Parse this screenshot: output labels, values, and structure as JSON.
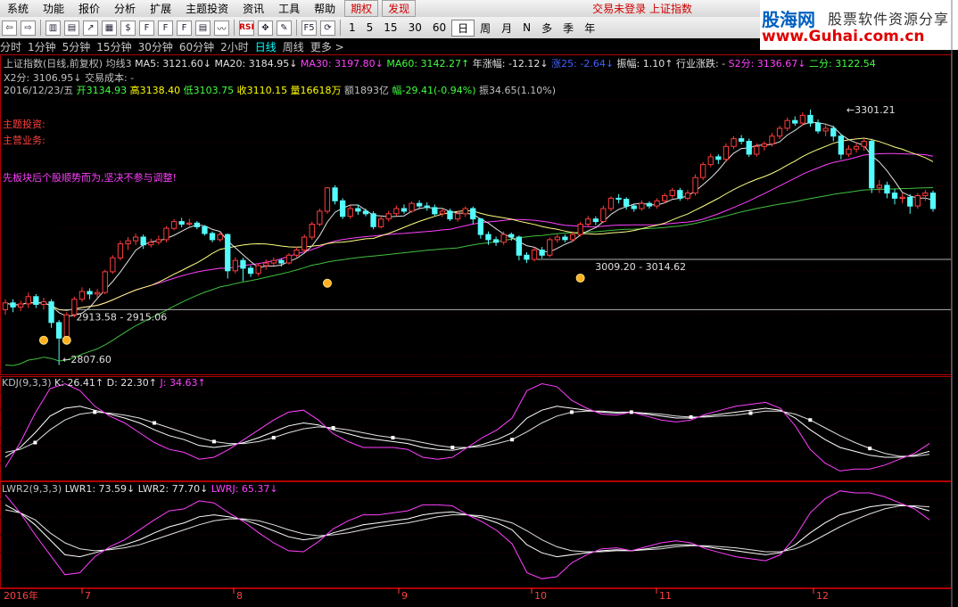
{
  "menu": {
    "items": [
      "系统",
      "功能",
      "报价",
      "分析",
      "扩展",
      "主题投资",
      "资讯",
      "工具",
      "帮助"
    ],
    "boxed": [
      "期权",
      "发现"
    ],
    "status": "交易未登录",
    "index_name": "上证指数"
  },
  "toolbar": {
    "icons": [
      "left-icon",
      "right-icon",
      "kline-icon",
      "bars-icon",
      "trend-icon",
      "grid-icon",
      "fund-icon",
      "f10-icon",
      "f10x-icon",
      "fiz-icon",
      "table-icon",
      "scan-icon",
      "rsi-icon",
      "move-icon",
      "pen-icon",
      "f5-icon",
      "refresh-icon"
    ],
    "rsi_label": "RSI",
    "periods": [
      "1",
      "5",
      "15",
      "30",
      "60",
      "日",
      "周",
      "月",
      "N",
      "多",
      "季",
      "年"
    ],
    "selected_period": "日"
  },
  "logo": {
    "name": "股海网",
    "slogan": "股票软件资源分享",
    "url": "www.Guhai.com.cn"
  },
  "period_bar": {
    "items": [
      "分时",
      "1分钟",
      "5分钟",
      "15分钟",
      "30分钟",
      "60分钟",
      "2小时",
      "日线",
      "周线",
      "更多 >"
    ],
    "current": "日线"
  },
  "info": {
    "line1": [
      {
        "text": "上证指数(日线,前复权) 均线3",
        "color": "#c0c0c0"
      },
      {
        "text": " MA5: 3121.60↓",
        "color": "#e0e0e0"
      },
      {
        "text": " MA20: 3184.95↓",
        "color": "#e0e0e0"
      },
      {
        "text": " MA30: 3197.80↓",
        "color": "#ff40ff"
      },
      {
        "text": " MA60: 3142.27↑",
        "color": "#40ff40"
      },
      {
        "text": "  年涨幅: -12.12↓",
        "color": "#e0e0e0"
      },
      {
        "text": " 涨25: -2.64↓",
        "color": "#4060ff"
      },
      {
        "text": " 振幅: 1.10↑",
        "color": "#e0e0e0"
      },
      {
        "text": " 行业涨跌: -",
        "color": "#e0e0e0"
      },
      {
        "text": " S2分: 3136.67↓",
        "color": "#ff40ff"
      },
      {
        "text": " 二分: 3122.54",
        "color": "#40ff40"
      }
    ],
    "line2": "X2分: 3106.95↓  交易成本: -",
    "line3": [
      {
        "text": "2016/12/23/五 ",
        "color": "#c0c0c0"
      },
      {
        "text": "开3134.93",
        "color": "#40ff40"
      },
      {
        "text": " 高3138.40",
        "color": "#ffff00"
      },
      {
        "text": " 低3103.75",
        "color": "#40ff40"
      },
      {
        "text": " 收3110.15",
        "color": "#ffff00"
      },
      {
        "text": " 量16618万",
        "color": "#ffff00"
      },
      {
        "text": " 额1893亿",
        "color": "#c0c0c0"
      },
      {
        "text": " 幅-29.41(-0.94%)",
        "color": "#40ff40"
      },
      {
        "text": " 振34.65(1.10%)",
        "color": "#c0c0c0"
      }
    ]
  },
  "annotations": {
    "a1": "主题投资:",
    "a2": "主营业务:",
    "a3": "先板块后个股顺势而为,坚决不参与调整!"
  },
  "price_labels": {
    "high": "3301.21",
    "low": "2807.60",
    "range1": "2913.58 - 2915.06",
    "range2": "3009.20 - 3014.62"
  },
  "kdj": {
    "label": "KDJ(9,3,3)",
    "k": "K: 26.41↑",
    "d": "D: 22.30↑",
    "j": "J: 34.63↑"
  },
  "lwr": {
    "label": "LWR2(9,3,3)",
    "lwr1": "LWR1: 73.59↓",
    "lwr2": "LWR2: 77.70↓",
    "lwrj": "LWRJ: 65.37↓"
  },
  "xaxis": {
    "year": "2016年",
    "months": [
      "7",
      "8",
      "9",
      "10",
      "11",
      "12"
    ]
  },
  "colors": {
    "up": "#ff3c3c",
    "down": "#54fcfc",
    "ma5": "#e0e0e0",
    "ma_yellow": "#ffff80",
    "ma_purple": "#ff40ff",
    "ma_green": "#40c040",
    "border": "#b00000"
  },
  "chart_data": {
    "type": "candlestick",
    "series_order": [
      "open",
      "close",
      "high",
      "low"
    ],
    "candles": [
      [
        2915,
        2928,
        2935,
        2905
      ],
      [
        2928,
        2920,
        2935,
        2910
      ],
      [
        2920,
        2926,
        2932,
        2912
      ],
      [
        2926,
        2940,
        2948,
        2918
      ],
      [
        2940,
        2925,
        2945,
        2918
      ],
      [
        2925,
        2930,
        2938,
        2915
      ],
      [
        2930,
        2890,
        2935,
        2880
      ],
      [
        2890,
        2860,
        2895,
        2808
      ],
      [
        2860,
        2905,
        2910,
        2855
      ],
      [
        2905,
        2935,
        2940,
        2900
      ],
      [
        2935,
        2950,
        2958,
        2930
      ],
      [
        2950,
        2945,
        2956,
        2935
      ],
      [
        2945,
        2948,
        2955,
        2938
      ],
      [
        2948,
        2988,
        2992,
        2945
      ],
      [
        2988,
        3015,
        3020,
        2984
      ],
      [
        3015,
        3042,
        3048,
        3010
      ],
      [
        3042,
        3048,
        3055,
        3030
      ],
      [
        3048,
        3055,
        3062,
        3040
      ],
      [
        3055,
        3040,
        3060,
        3032
      ],
      [
        3040,
        3045,
        3052,
        3035
      ],
      [
        3045,
        3050,
        3058,
        3040
      ],
      [
        3050,
        3072,
        3076,
        3045
      ],
      [
        3072,
        3085,
        3090,
        3068
      ],
      [
        3085,
        3080,
        3092,
        3074
      ],
      [
        3080,
        3082,
        3090,
        3076
      ],
      [
        3082,
        3075,
        3086,
        3070
      ],
      [
        3075,
        3062,
        3078,
        3058
      ],
      [
        3062,
        3050,
        3066,
        3045
      ],
      [
        3050,
        3060,
        3064,
        3046
      ],
      [
        3060,
        2990,
        3062,
        2975
      ],
      [
        2990,
        3010,
        3016,
        2985
      ],
      [
        3010,
        2995,
        3015,
        2970
      ],
      [
        2995,
        2985,
        3000,
        2978
      ],
      [
        2985,
        3000,
        3004,
        2980
      ],
      [
        3000,
        3005,
        3012,
        2992
      ],
      [
        3005,
        3010,
        3016,
        3000
      ],
      [
        3010,
        3005,
        3014,
        2998
      ],
      [
        3005,
        3020,
        3024,
        3002
      ],
      [
        3020,
        3030,
        3036,
        3016
      ],
      [
        3030,
        3055,
        3060,
        3026
      ],
      [
        3055,
        3080,
        3085,
        3050
      ],
      [
        3080,
        3105,
        3110,
        3076
      ],
      [
        3105,
        3150,
        3152,
        3100
      ],
      [
        3150,
        3125,
        3155,
        3118
      ],
      [
        3125,
        3095,
        3130,
        3090
      ],
      [
        3095,
        3110,
        3116,
        3090
      ],
      [
        3110,
        3105,
        3118,
        3098
      ],
      [
        3105,
        3100,
        3110,
        3095
      ],
      [
        3100,
        3075,
        3105,
        3070
      ],
      [
        3075,
        3090,
        3096,
        3072
      ],
      [
        3090,
        3100,
        3106,
        3085
      ],
      [
        3100,
        3110,
        3116,
        3096
      ],
      [
        3110,
        3105,
        3118,
        3100
      ],
      [
        3105,
        3120,
        3124,
        3102
      ],
      [
        3120,
        3115,
        3126,
        3110
      ],
      [
        3115,
        3112,
        3122,
        3106
      ],
      [
        3112,
        3100,
        3118,
        3096
      ],
      [
        3100,
        3105,
        3110,
        3094
      ],
      [
        3105,
        3090,
        3110,
        3086
      ],
      [
        3090,
        3100,
        3106,
        3085
      ],
      [
        3100,
        3110,
        3114,
        3094
      ],
      [
        3110,
        3090,
        3114,
        3080
      ],
      [
        3090,
        3060,
        3092,
        3052
      ],
      [
        3060,
        3050,
        3066,
        3040
      ],
      [
        3050,
        3045,
        3056,
        3038
      ],
      [
        3045,
        3060,
        3066,
        3040
      ],
      [
        3060,
        3055,
        3064,
        3048
      ],
      [
        3055,
        3020,
        3058,
        3010
      ],
      [
        3020,
        3012,
        3026,
        3005
      ],
      [
        3012,
        3030,
        3035,
        3008
      ],
      [
        3030,
        3020,
        3036,
        3014
      ],
      [
        3020,
        3050,
        3054,
        3016
      ],
      [
        3050,
        3055,
        3060,
        3044
      ],
      [
        3055,
        3050,
        3060,
        3045
      ],
      [
        3050,
        3060,
        3066,
        3046
      ],
      [
        3060,
        3080,
        3084,
        3056
      ],
      [
        3080,
        3090,
        3096,
        3075
      ],
      [
        3090,
        3085,
        3095,
        3078
      ],
      [
        3085,
        3110,
        3116,
        3082
      ],
      [
        3110,
        3130,
        3134,
        3105
      ],
      [
        3130,
        3128,
        3138,
        3120
      ],
      [
        3128,
        3115,
        3132,
        3108
      ],
      [
        3115,
        3110,
        3120,
        3104
      ],
      [
        3110,
        3120,
        3126,
        3106
      ],
      [
        3120,
        3115,
        3124,
        3110
      ],
      [
        3115,
        3125,
        3130,
        3110
      ],
      [
        3125,
        3135,
        3140,
        3120
      ],
      [
        3135,
        3145,
        3150,
        3130
      ],
      [
        3145,
        3130,
        3150,
        3125
      ],
      [
        3130,
        3140,
        3146,
        3126
      ],
      [
        3140,
        3170,
        3176,
        3135
      ],
      [
        3170,
        3195,
        3200,
        3165
      ],
      [
        3195,
        3210,
        3216,
        3190
      ],
      [
        3210,
        3205,
        3215,
        3196
      ],
      [
        3205,
        3230,
        3236,
        3200
      ],
      [
        3230,
        3245,
        3250,
        3225
      ],
      [
        3245,
        3240,
        3252,
        3234
      ],
      [
        3240,
        3215,
        3245,
        3210
      ],
      [
        3215,
        3230,
        3236,
        3210
      ],
      [
        3230,
        3235,
        3240,
        3222
      ],
      [
        3235,
        3250,
        3256,
        3230
      ],
      [
        3250,
        3265,
        3270,
        3244
      ],
      [
        3265,
        3280,
        3286,
        3260
      ],
      [
        3280,
        3275,
        3288,
        3270
      ],
      [
        3275,
        3290,
        3296,
        3270
      ],
      [
        3290,
        3275,
        3301,
        3268
      ],
      [
        3275,
        3260,
        3282,
        3255
      ],
      [
        3260,
        3265,
        3275,
        3250
      ],
      [
        3265,
        3250,
        3270,
        3240
      ],
      [
        3250,
        3215,
        3254,
        3205
      ],
      [
        3215,
        3225,
        3232,
        3210
      ],
      [
        3225,
        3230,
        3238,
        3218
      ],
      [
        3230,
        3240,
        3246,
        3222
      ],
      [
        3240,
        3150,
        3245,
        3140
      ],
      [
        3150,
        3155,
        3165,
        3140
      ],
      [
        3155,
        3140,
        3162,
        3130
      ],
      [
        3140,
        3130,
        3148,
        3118
      ],
      [
        3130,
        3132,
        3140,
        3120
      ],
      [
        3132,
        3115,
        3138,
        3100
      ],
      [
        3115,
        3135,
        3140,
        3110
      ],
      [
        3135,
        3140,
        3146,
        3125
      ],
      [
        3140,
        3110,
        3145,
        3104
      ]
    ],
    "ylim": [
      2790,
      3320
    ],
    "kdj": {
      "k": [
        20,
        30,
        45,
        62,
        70,
        72,
        68,
        64,
        60,
        55,
        48,
        42,
        38,
        32,
        30,
        32,
        35,
        40,
        46,
        52,
        55,
        53,
        48,
        44,
        40,
        38,
        36,
        34,
        30,
        28,
        27,
        30,
        33,
        38,
        45,
        60,
        68,
        72,
        70,
        68,
        66,
        65,
        66,
        64,
        62,
        60,
        60,
        62,
        64,
        66,
        68,
        70,
        68,
        60,
        48,
        38,
        30,
        26,
        22,
        20,
        20,
        22,
        26
      ],
      "d": [
        25,
        28,
        35,
        48,
        58,
        64,
        66,
        65,
        63,
        60,
        55,
        50,
        45,
        40,
        36,
        34,
        34,
        36,
        40,
        45,
        49,
        51,
        50,
        48,
        45,
        42,
        40,
        38,
        35,
        32,
        30,
        30,
        31,
        34,
        38,
        46,
        55,
        62,
        66,
        67,
        67,
        66,
        66,
        65,
        64,
        62,
        61,
        61,
        62,
        63,
        65,
        67,
        67,
        64,
        58,
        50,
        42,
        35,
        29,
        24,
        21,
        21,
        23
      ],
      "j": [
        10,
        35,
        65,
        90,
        95,
        88,
        72,
        62,
        55,
        45,
        35,
        28,
        25,
        18,
        20,
        28,
        38,
        48,
        58,
        66,
        68,
        58,
        44,
        36,
        30,
        30,
        30,
        28,
        20,
        18,
        20,
        30,
        40,
        48,
        60,
        88,
        95,
        92,
        78,
        70,
        64,
        63,
        66,
        62,
        58,
        56,
        58,
        64,
        68,
        72,
        74,
        76,
        70,
        52,
        28,
        14,
        6,
        8,
        8,
        12,
        18,
        24,
        34
      ]
    },
    "lwr": {
      "lwr1": [
        80,
        72,
        60,
        45,
        30,
        28,
        32,
        36,
        40,
        45,
        52,
        58,
        62,
        68,
        70,
        68,
        65,
        60,
        54,
        48,
        45,
        47,
        52,
        56,
        60,
        62,
        64,
        66,
        70,
        72,
        73,
        70,
        67,
        62,
        55,
        40,
        32,
        28,
        30,
        32,
        34,
        35,
        34,
        36,
        38,
        40,
        40,
        38,
        36,
        34,
        32,
        30,
        32,
        40,
        52,
        62,
        70,
        74,
        78,
        80,
        80,
        78,
        74
      ],
      "lwr2": [
        75,
        72,
        65,
        52,
        42,
        36,
        34,
        35,
        37,
        40,
        45,
        50,
        55,
        60,
        64,
        66,
        66,
        64,
        60,
        55,
        51,
        49,
        50,
        52,
        55,
        58,
        60,
        62,
        65,
        68,
        70,
        70,
        69,
        66,
        62,
        54,
        45,
        38,
        34,
        33,
        33,
        34,
        34,
        35,
        36,
        38,
        39,
        39,
        38,
        37,
        35,
        33,
        33,
        36,
        42,
        50,
        58,
        65,
        71,
        76,
        79,
        79,
        78
      ],
      "lwrj": [
        90,
        72,
        50,
        30,
        10,
        12,
        28,
        38,
        45,
        55,
        65,
        74,
        76,
        84,
        82,
        72,
        63,
        52,
        42,
        34,
        33,
        43,
        56,
        64,
        70,
        70,
        72,
        74,
        80,
        80,
        79,
        70,
        63,
        54,
        41,
        12,
        6,
        8,
        22,
        30,
        36,
        37,
        34,
        38,
        42,
        44,
        42,
        36,
        32,
        28,
        26,
        24,
        30,
        48,
        72,
        86,
        94,
        92,
        92,
        88,
        82,
        76,
        65
      ]
    }
  }
}
